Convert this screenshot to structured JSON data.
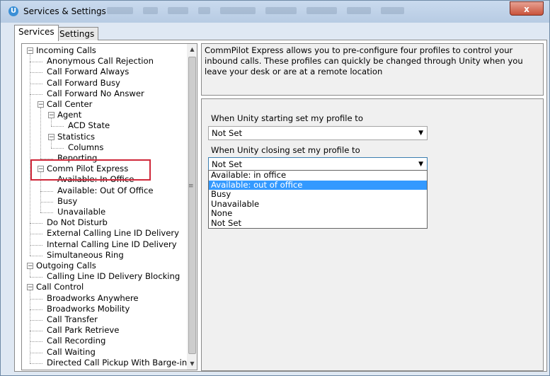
{
  "window": {
    "title": "Services & Settings",
    "app_icon_letter": "U",
    "close_label": "x"
  },
  "tabs": [
    {
      "label": "Services",
      "active": true
    },
    {
      "label": "Settings",
      "active": false
    }
  ],
  "tree": [
    {
      "label": "Incoming Calls",
      "level": 0,
      "expander": "-"
    },
    {
      "label": "Anonymous Call Rejection",
      "level": 1
    },
    {
      "label": "Call Forward Always",
      "level": 1
    },
    {
      "label": "Call Forward Busy",
      "level": 1
    },
    {
      "label": "Call Forward No Answer",
      "level": 1
    },
    {
      "label": "Call Center",
      "level": 1,
      "expander": "-"
    },
    {
      "label": "Agent",
      "level": 2,
      "expander": "-"
    },
    {
      "label": "ACD State",
      "level": 3
    },
    {
      "label": "Statistics",
      "level": 2,
      "expander": "-"
    },
    {
      "label": "Columns",
      "level": 3
    },
    {
      "label": "Reporting",
      "level": 2
    },
    {
      "label": "Comm Pilot Express",
      "level": 1,
      "expander": "-"
    },
    {
      "label": "Available: In Office",
      "level": 2
    },
    {
      "label": "Available: Out Of Office",
      "level": 2
    },
    {
      "label": "Busy",
      "level": 2
    },
    {
      "label": "Unavailable",
      "level": 2
    },
    {
      "label": "Do Not Disturb",
      "level": 1
    },
    {
      "label": "External Calling Line ID Delivery",
      "level": 1
    },
    {
      "label": "Internal Calling Line ID Delivery",
      "level": 1
    },
    {
      "label": "Simultaneous Ring",
      "level": 1
    },
    {
      "label": "Outgoing Calls",
      "level": 0,
      "expander": "-"
    },
    {
      "label": "Calling Line ID Delivery Blocking",
      "level": 1
    },
    {
      "label": "Call Control",
      "level": 0,
      "expander": "-"
    },
    {
      "label": "Broadworks Anywhere",
      "level": 1
    },
    {
      "label": "Broadworks Mobility",
      "level": 1
    },
    {
      "label": "Call Transfer",
      "level": 1
    },
    {
      "label": "Call Park Retrieve",
      "level": 1
    },
    {
      "label": "Call Recording",
      "level": 1
    },
    {
      "label": "Call Waiting",
      "level": 1
    },
    {
      "label": "Directed Call Pickup With Barge-in",
      "level": 1
    }
  ],
  "info": {
    "text": "CommPilot Express allows you to pre-configure four profiles to control your inbound calls. These profiles can quickly be changed through Unity when you leave your desk or are at a remote location"
  },
  "settings": {
    "starting_label": "When Unity starting set my profile to",
    "starting_value": "Not Set",
    "closing_label": "When Unity closing set my profile to",
    "closing_value": "Not Set",
    "options": [
      {
        "label": "Available: in office",
        "selected": false
      },
      {
        "label": "Available: out of office",
        "selected": true
      },
      {
        "label": "Busy",
        "selected": false
      },
      {
        "label": "Unavailable",
        "selected": false
      },
      {
        "label": "None",
        "selected": false
      },
      {
        "label": "Not Set",
        "selected": false
      }
    ]
  },
  "icons": {
    "expander": "minus-box-icon",
    "dropdown_arrow": "chevron-down-icon",
    "scroll_up": "arrow-up-icon",
    "scroll_down": "arrow-down-icon"
  },
  "colors": {
    "highlight_box": "#d0283a",
    "selection": "#3399ff"
  }
}
